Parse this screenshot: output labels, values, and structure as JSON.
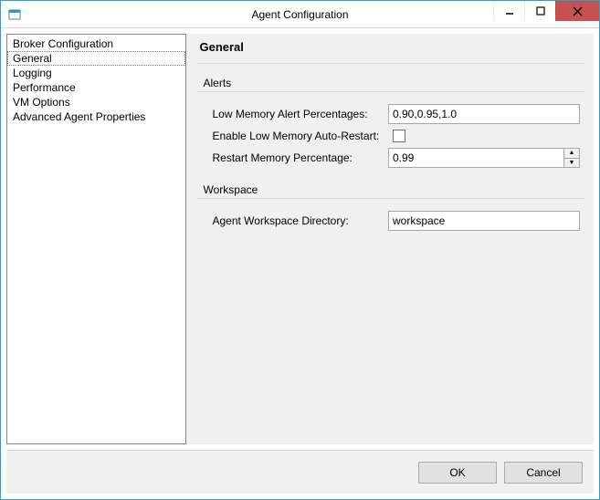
{
  "window": {
    "title": "Agent Configuration"
  },
  "sidebar": {
    "items": [
      {
        "label": "Broker Configuration"
      },
      {
        "label": "General"
      },
      {
        "label": "Logging"
      },
      {
        "label": "Performance"
      },
      {
        "label": "VM Options"
      },
      {
        "label": "Advanced Agent Properties"
      }
    ],
    "selectedIndex": 1
  },
  "content": {
    "title": "General",
    "alerts": {
      "group_label": "Alerts",
      "low_mem_pct_label": "Low Memory Alert Percentages:",
      "low_mem_pct_value": "0.90,0.95,1.0",
      "auto_restart_label": "Enable Low Memory Auto-Restart:",
      "auto_restart_checked": false,
      "restart_pct_label": "Restart Memory Percentage:",
      "restart_pct_value": "0.99"
    },
    "workspace": {
      "group_label": "Workspace",
      "dir_label": "Agent Workspace Directory:",
      "dir_value": "workspace"
    }
  },
  "footer": {
    "ok": "OK",
    "cancel": "Cancel"
  }
}
